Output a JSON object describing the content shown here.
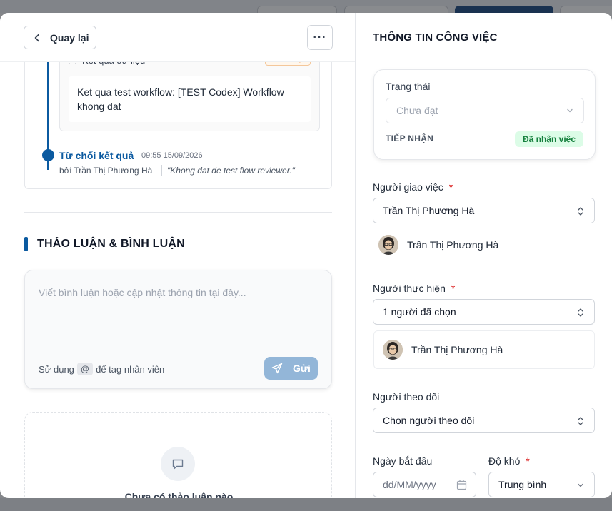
{
  "left": {
    "back_label": "Quay lại",
    "more_label": "···",
    "result": {
      "title": "Kết quả dữ liệu",
      "badge": "Chưa đạt",
      "body": "Ket qua test workflow: [TEST Codex] Workflow khong dat"
    },
    "timeline": {
      "title": "Từ chối kết quả",
      "time": "09:55 15/09/2026",
      "by": "bởi Trần Thị Phương Hà",
      "quote": "\"Khong dat de test flow reviewer.\""
    },
    "discussion": {
      "title": "THẢO LUẬN & BÌNH LUẬN",
      "placeholder": "Viết bình luận hoặc cập nhật thông tin tại đây...",
      "hint_before": "Sử dụng",
      "hint_at": "@",
      "hint_after": "để tag nhân viên",
      "send_label": "Gửi",
      "empty_text": "Chưa có thảo luận nào"
    }
  },
  "right": {
    "title": "THÔNG TIN CÔNG VIỆC",
    "status": {
      "label": "Trạng thái",
      "value": "Chưa đạt",
      "receive_label": "TIẾP NHẬN",
      "receive_badge": "Đã nhận việc"
    },
    "assigner": {
      "label": "Người giao việc",
      "required": "*",
      "value": "Trần Thị Phương Hà",
      "person": "Trần Thị Phương Hà"
    },
    "assignee": {
      "label": "Người thực hiện",
      "required": "*",
      "value": "1 người đã chọn",
      "person": "Trần Thị Phương Hà"
    },
    "follower": {
      "label": "Người theo dõi",
      "value": "Chọn người theo dõi"
    },
    "start_date": {
      "label": "Ngày bắt đầu",
      "placeholder": "dd/MM/yyyy"
    },
    "difficulty": {
      "label": "Độ khó",
      "required": "*",
      "value": "Trung bình"
    }
  },
  "colors": {
    "accent": "#0b5aa0",
    "danger": "#dc2626",
    "success_bg": "#dcfce7",
    "success_text": "#15803d",
    "send_button": "#93b6d8"
  },
  "icons": [
    "chevron-left-icon",
    "more-icon",
    "send-icon",
    "chat-bubble-icon",
    "chevron-down-icon",
    "updown-icon",
    "calendar-icon",
    "checkbox-icon"
  ]
}
